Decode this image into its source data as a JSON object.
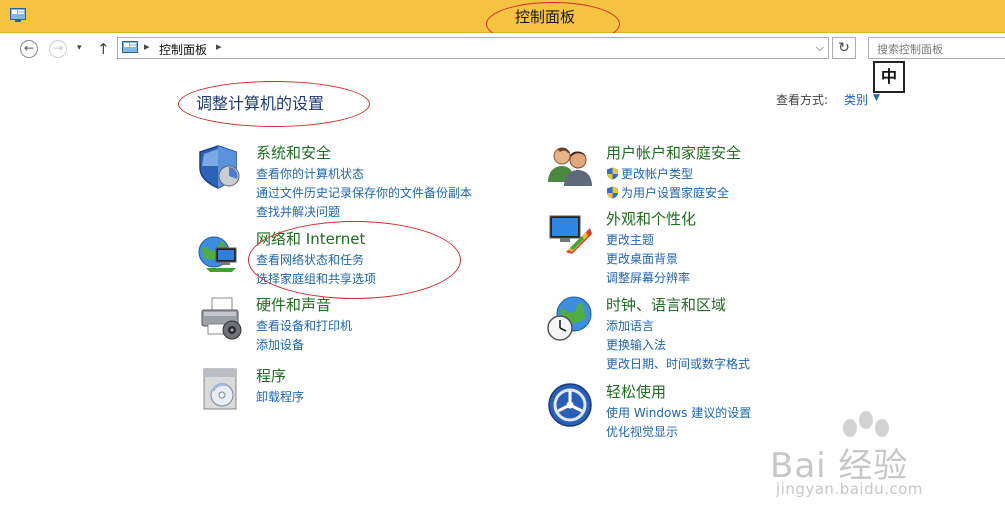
{
  "window": {
    "title": "控制面板"
  },
  "navbar": {
    "back_glyph": "←",
    "forward_glyph": "→",
    "recent_glyph": "▾",
    "up_glyph": "↑",
    "breadcrumb_separator": "▸",
    "breadcrumb": "控制面板",
    "address_dropdown_glyph": "⌵",
    "refresh_glyph": "↻",
    "search_placeholder": "搜索控制面板"
  },
  "ime_indicator": "中",
  "main": {
    "heading": "调整计算机的设置",
    "view_by_label": "查看方式:",
    "view_by_value": "类别",
    "view_by_arrow": "▼"
  },
  "categories_left": [
    {
      "title": "系统和安全",
      "icon": "shield-icon",
      "links": [
        "查看你的计算机状态",
        "通过文件历史记录保存你的文件备份副本",
        "查找并解决问题"
      ]
    },
    {
      "title": "网络和 Internet",
      "icon": "network-globe-icon",
      "links": [
        "查看网络状态和任务",
        "选择家庭组和共享选项"
      ]
    },
    {
      "title": "硬件和声音",
      "icon": "printer-icon",
      "links": [
        "查看设备和打印机",
        "添加设备"
      ]
    },
    {
      "title": "程序",
      "icon": "programs-icon",
      "links": [
        "卸载程序"
      ]
    }
  ],
  "categories_right": [
    {
      "title": "用户帐户和家庭安全",
      "icon": "users-icon",
      "links": [
        "更改帐户类型",
        "为用户设置家庭安全"
      ]
    },
    {
      "title": "外观和个性化",
      "icon": "appearance-icon",
      "links": [
        "更改主题",
        "更改桌面背景",
        "调整屏幕分辨率"
      ]
    },
    {
      "title": "时钟、语言和区域",
      "icon": "clock-globe-icon",
      "links": [
        "添加语言",
        "更换输入法",
        "更改日期、时间或数字格式"
      ]
    },
    {
      "title": "轻松使用",
      "icon": "ease-of-access-icon",
      "links": [
        "使用 Windows 建议的设置",
        "优化视觉显示"
      ]
    }
  ],
  "watermark": {
    "brand": "Bai 经验",
    "url": "jingyan.baidu.com"
  },
  "colors": {
    "titlebar": "#f4c341",
    "link": "#1e64b4",
    "category_title": "#1f6d1f",
    "annotation": "#d22b2b"
  }
}
